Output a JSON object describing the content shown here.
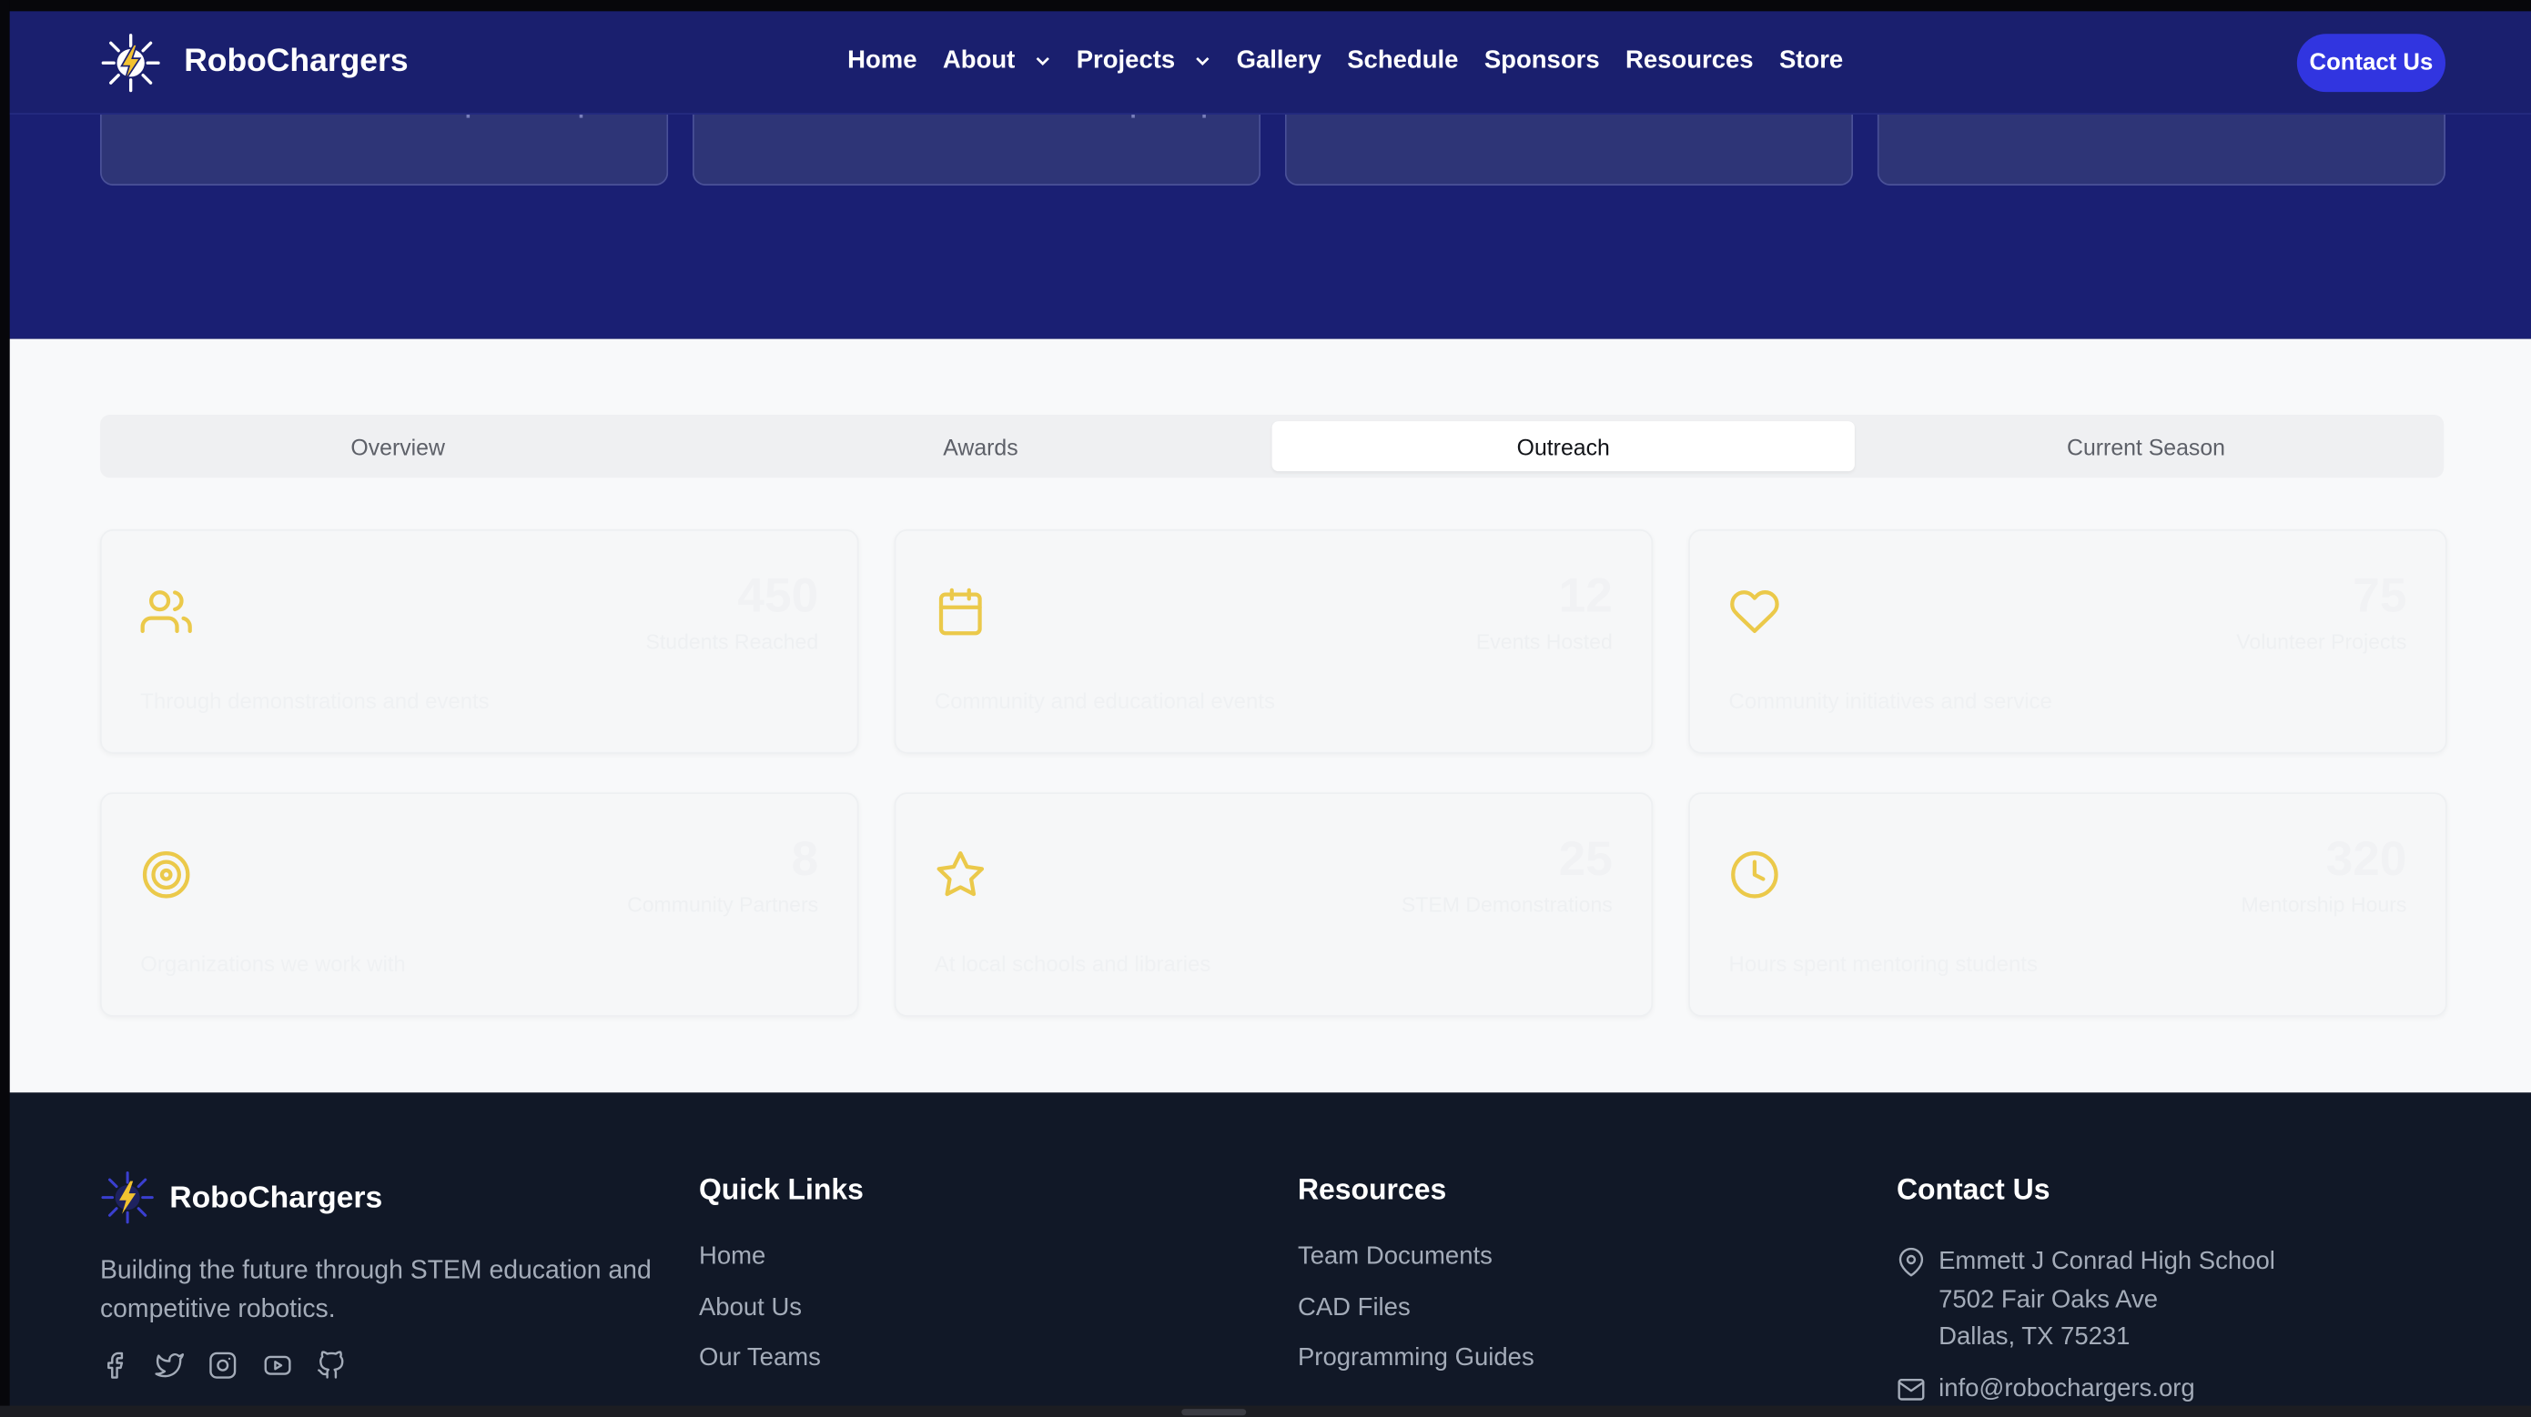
{
  "brand": {
    "name": "RoboChargers"
  },
  "nav": {
    "items": [
      {
        "label": "Home",
        "dropdown": false
      },
      {
        "label": "About",
        "dropdown": true
      },
      {
        "label": "Projects",
        "dropdown": true
      },
      {
        "label": "Gallery",
        "dropdown": false
      },
      {
        "label": "Schedule",
        "dropdown": false
      },
      {
        "label": "Sponsors",
        "dropdown": false
      },
      {
        "label": "Resources",
        "dropdown": false
      },
      {
        "label": "Store",
        "dropdown": false
      }
    ],
    "cta": "Contact Us"
  },
  "tabs": {
    "items": [
      "Overview",
      "Awards",
      "Outreach",
      "Current Season"
    ],
    "active": "Outreach"
  },
  "stats": [
    {
      "icon": "users-icon",
      "value": "450",
      "label": "Students Reached",
      "desc": "Through demonstrations and events"
    },
    {
      "icon": "calendar-icon",
      "value": "12",
      "label": "Events Hosted",
      "desc": "Community and educational events"
    },
    {
      "icon": "heart-icon",
      "value": "75",
      "label": "Volunteer Projects",
      "desc": "Community initiatives and service"
    },
    {
      "icon": "target-icon",
      "value": "8",
      "label": "Community Partners",
      "desc": "Organizations we work with"
    },
    {
      "icon": "star-icon",
      "value": "25",
      "label": "STEM Demonstrations",
      "desc": "At local schools and libraries"
    },
    {
      "icon": "clock-icon",
      "value": "320",
      "label": "Mentorship Hours",
      "desc": "Hours spent mentoring students"
    }
  ],
  "footer": {
    "tagline": "Building the future through STEM education and competitive robotics.",
    "socials": [
      "facebook-icon",
      "twitter-icon",
      "instagram-icon",
      "youtube-icon",
      "github-icon"
    ],
    "quick_links": {
      "title": "Quick Links",
      "items": [
        "Home",
        "About Us",
        "Our Teams"
      ]
    },
    "resources": {
      "title": "Resources",
      "items": [
        "Team Documents",
        "CAD Files",
        "Programming Guides"
      ]
    },
    "contact": {
      "title": "Contact Us",
      "address": [
        "Emmett J Conrad High School",
        "7502 Fair Oaks Ave",
        "Dallas, TX 75231"
      ],
      "email": "info@robochargers.org"
    }
  },
  "colors": {
    "nav_bg": "#1a1f6e",
    "hero_bg": "#1a1f73",
    "accent": "#3135e0",
    "icon_gold": "#ebc94a",
    "footer_bg": "#111827"
  }
}
